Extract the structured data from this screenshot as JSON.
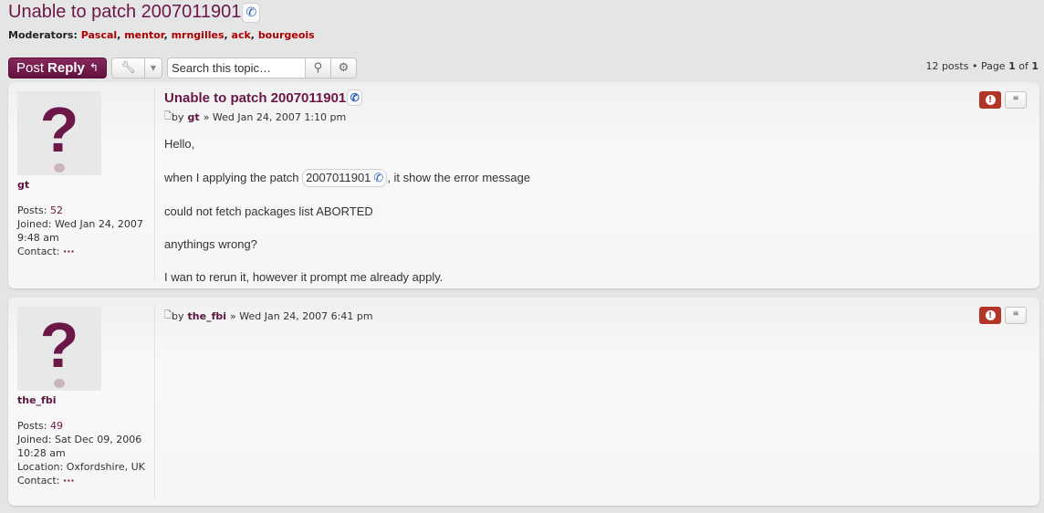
{
  "topic": {
    "title": "Unable to patch 2007011901",
    "phone_icon": "phone-icon"
  },
  "moderators": {
    "label": "Moderators:",
    "names": [
      "Pascal",
      "mentor",
      "mrngilles",
      "ack",
      "bourgeois"
    ]
  },
  "action_bar": {
    "post_label": "Post",
    "reply_label": "Reply",
    "reply_icon": "reply-arrow-icon",
    "tools_icon": "wrench-icon",
    "dropdown_icon": "caret-down-icon",
    "search_placeholder": "Search this topic…",
    "search_icon": "search-icon",
    "advanced_search_icon": "gear-icon"
  },
  "pagination": {
    "posts_count": "12 posts",
    "separator": "•",
    "page_label": "Page",
    "current_page": "1",
    "of_label": "of",
    "total_pages": "1"
  },
  "posts": [
    {
      "username": "gt",
      "posts_label": "Posts:",
      "posts_count": "52",
      "joined_label": "Joined:",
      "joined": "Wed Jan 24, 2007 9:48 am",
      "contact_label": "Contact:",
      "contact_value": "···",
      "title": "Unable to patch 2007011901",
      "by_label": "by",
      "author": "gt",
      "date_sep": "»",
      "date": "Wed Jan 24, 2007 1:10 pm",
      "content": {
        "line1": "Hello,",
        "line2_before": "when I applying the patch",
        "line2_patch": "2007011901",
        "line2_after": ", it show the error message",
        "line3": "could not fetch packages list ABORTED",
        "line4": "anythings wrong?",
        "line5": "I wan to rerun it, however it prompt me already apply."
      },
      "report_icon": "report-icon",
      "quote_icon": "quote-icon"
    },
    {
      "username": "the_fbi",
      "posts_label": "Posts:",
      "posts_count": "49",
      "joined_label": "Joined:",
      "joined": "Sat Dec 09, 2006 10:28 am",
      "location_label": "Location:",
      "location": "Oxfordshire, UK",
      "contact_label": "Contact:",
      "contact_value": "···",
      "by_label": "by",
      "author": "the_fbi",
      "date_sep": "»",
      "date": "Wed Jan 24, 2007 6:41 pm",
      "report_icon": "report-icon",
      "quote_icon": "quote-icon"
    }
  ]
}
